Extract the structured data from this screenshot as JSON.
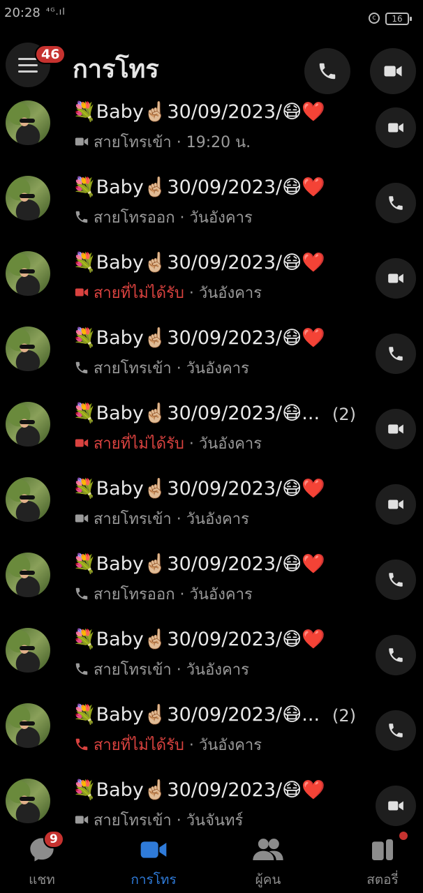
{
  "status_bar": {
    "time": "20:28",
    "signal": "⁴ᴳ.ıl",
    "battery": "16"
  },
  "header": {
    "title": "การโทร",
    "menu_badge": "46"
  },
  "calls": [
    {
      "name": "💐Baby☝🏼30/09/2023/😷❤️",
      "type": "video",
      "status": "สายโทรเข้า",
      "time": "19:20 น.",
      "missed": false,
      "count": "",
      "action": "video"
    },
    {
      "name": "💐Baby☝🏼30/09/2023/😷❤️",
      "type": "phone",
      "status": "สายโทรออก",
      "time": "วันอังคาร",
      "missed": false,
      "count": "",
      "action": "phone"
    },
    {
      "name": "💐Baby☝🏼30/09/2023/😷❤️",
      "type": "video",
      "status": "สายที่ไม่ได้รับ",
      "time": "วันอังคาร",
      "missed": true,
      "count": "",
      "action": "video"
    },
    {
      "name": "💐Baby☝🏼30/09/2023/😷❤️",
      "type": "phone",
      "status": "สายโทรเข้า",
      "time": "วันอังคาร",
      "missed": false,
      "count": "",
      "action": "phone"
    },
    {
      "name": "💐Baby☝🏼30/09/2023/😷...",
      "type": "video",
      "status": "สายที่ไม่ได้รับ",
      "time": "วันอังคาร",
      "missed": true,
      "count": "(2)",
      "action": "video"
    },
    {
      "name": "💐Baby☝🏼30/09/2023/😷❤️",
      "type": "video",
      "status": "สายโทรเข้า",
      "time": "วันอังคาร",
      "missed": false,
      "count": "",
      "action": "video"
    },
    {
      "name": "💐Baby☝🏼30/09/2023/😷❤️",
      "type": "phone",
      "status": "สายโทรออก",
      "time": "วันอังคาร",
      "missed": false,
      "count": "",
      "action": "phone"
    },
    {
      "name": "💐Baby☝🏼30/09/2023/😷❤️",
      "type": "phone",
      "status": "สายโทรเข้า",
      "time": "วันอังคาร",
      "missed": false,
      "count": "",
      "action": "phone"
    },
    {
      "name": "💐Baby☝🏼30/09/2023/😷...",
      "type": "phone",
      "status": "สายที่ไม่ได้รับ",
      "time": "วันอังคาร",
      "missed": true,
      "count": "(2)",
      "action": "phone"
    },
    {
      "name": "💐Baby☝🏼30/09/2023/😷❤️",
      "type": "video",
      "status": "สายโทรเข้า",
      "time": "วันจันทร์",
      "missed": false,
      "count": "",
      "action": "video"
    }
  ],
  "nav": [
    {
      "label": "แชท",
      "icon": "chat-bubble-icon",
      "badge": "9",
      "active": false
    },
    {
      "label": "การโทร",
      "icon": "video-camera-icon",
      "badge": "",
      "active": true
    },
    {
      "label": "ผู้คน",
      "icon": "people-icon",
      "badge": "",
      "active": false
    },
    {
      "label": "สตอรี่",
      "icon": "stories-icon",
      "badge": "",
      "active": false
    }
  ],
  "colors": {
    "accent": "#2f7bd9",
    "missed": "#d9423f",
    "badge": "#c6322f"
  }
}
